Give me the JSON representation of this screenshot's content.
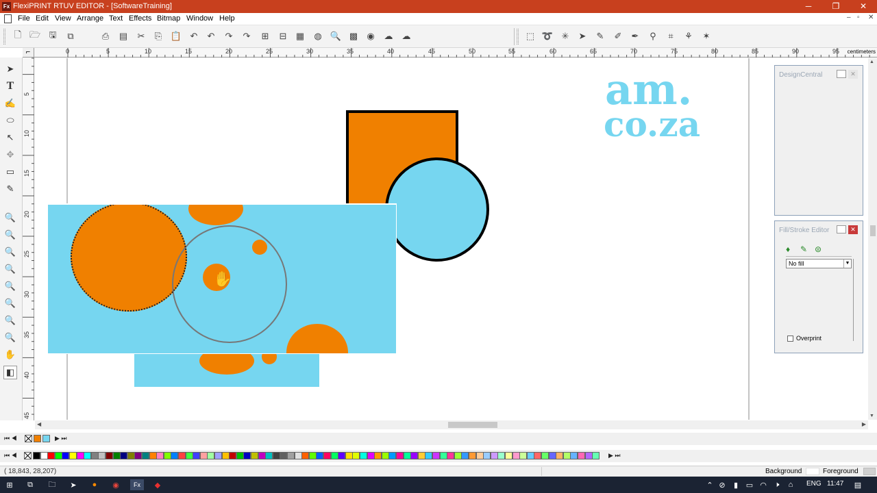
{
  "window": {
    "app_icon": "Fx",
    "title": "FlexiPRINT RTUV EDITOR - [SoftwareTraining]",
    "minimize": "─",
    "maximize": "❐",
    "close": "✕"
  },
  "menu": {
    "items": [
      "File",
      "Edit",
      "View",
      "Arrange",
      "Text",
      "Effects",
      "Bitmap",
      "Window",
      "Help"
    ],
    "mdi_minimize": "–",
    "mdi_restore": "▫",
    "mdi_close": "✕"
  },
  "toolbar": {
    "icons": [
      "new-icon",
      "open-icon",
      "save-icon",
      "save-all-icon",
      "print-icon",
      "production-manager-icon",
      "cut-icon",
      "copy-icon",
      "paste-icon",
      "undo-icon",
      "undo-list-icon",
      "redo-icon",
      "redo-list-icon",
      "group-icon",
      "ungroup-icon",
      "import-icon",
      "color-palette-icon",
      "zoom-icon",
      "color-swatch-icon",
      "color-wheel-icon",
      "cloud-icon",
      "cloud-upload-icon"
    ],
    "right_icons": [
      "marquee-select-icon",
      "lasso-select-icon",
      "magic-wand-icon",
      "arrow-select-icon",
      "pencil-icon",
      "brush-icon",
      "pen-icon",
      "stamp-icon",
      "crop-icon",
      "clone-icon",
      "wand-icon"
    ]
  },
  "ruler": {
    "corner": "⌐",
    "h_ticks": [
      "0",
      "5",
      "10",
      "15",
      "20",
      "25",
      "30",
      "35",
      "40",
      "45",
      "50",
      "55",
      "60",
      "65",
      "70",
      "75",
      "80",
      "85",
      "90",
      "95"
    ],
    "unit": "centimeters",
    "v_ticks": [
      "5",
      "10",
      "15",
      "20",
      "25",
      "30",
      "35",
      "40",
      "45"
    ]
  },
  "tools": [
    "select-tool-icon",
    "text-tool-icon",
    "shape-tool-icon",
    "ellipse-tool-icon",
    "node-edit-tool-icon",
    "fill-tool-icon",
    "measure-tool-icon",
    "eyedropper-tool-icon",
    "zoom-in-tool-icon",
    "zoom-out-tool-icon",
    "zoom-fit-tool-icon",
    "zoom-select-tool-icon",
    "zoom-all-tool-icon",
    "zoom-page-tool-icon",
    "pan-tool-icon",
    "fill-stroke-tool-icon"
  ],
  "artwork": {
    "logo_line1": "am.",
    "logo_line2": "co.za",
    "orange": "#f08000",
    "blue": "#76d6f0"
  },
  "panels": {
    "design_central": {
      "title": "DesignCentral"
    },
    "fill_stroke": {
      "title": "Fill/Stroke Editor",
      "fill_select": "No fill",
      "overprint_label": "Overprint"
    }
  },
  "palette": {
    "nav_left": "⏮ ◀",
    "nav_right": "▶ ⏭",
    "colors": [
      "#000000",
      "#ffffff",
      "#ff0000",
      "#00ff00",
      "#0000ff",
      "#ffff00",
      "#ff00ff",
      "#00ffff",
      "#808080",
      "#c0c0c0",
      "#800000",
      "#008000",
      "#000080",
      "#808000",
      "#800080",
      "#008080",
      "#ff8000",
      "#ff80c0",
      "#80ff00",
      "#0080ff",
      "#ff4040",
      "#40ff40",
      "#4040ff",
      "#ffa0a0",
      "#a0ffa0",
      "#a0a0ff",
      "#ffc000",
      "#c00000",
      "#00c000",
      "#0000c0",
      "#c0c000",
      "#c000c0",
      "#00c0c0",
      "#404040",
      "#606060",
      "#a0a0a0",
      "#e0e0e0",
      "#ff6000",
      "#60ff00",
      "#0060ff",
      "#ff0060",
      "#00ff60",
      "#6000ff",
      "#ffe000",
      "#e0ff00",
      "#00ffe0",
      "#e000ff",
      "#ff9900",
      "#99ff00",
      "#0099ff",
      "#ff0099",
      "#00ff99",
      "#9900ff",
      "#ffcc33",
      "#33ccff",
      "#cc33ff",
      "#33ff99",
      "#ff3399",
      "#99ff33",
      "#3399ff",
      "#ff9933",
      "#ffcc99",
      "#99ccff",
      "#cc99ff",
      "#99ffcc",
      "#ffff99",
      "#ff99cc",
      "#ccff99",
      "#66ccff",
      "#ff6666",
      "#66ff66",
      "#6666ff",
      "#ffb366",
      "#b3ff66",
      "#66b3ff",
      "#ff66b3",
      "#b366ff",
      "#66ffb3"
    ]
  },
  "status": {
    "coords": "( 18,843,    28,207)",
    "background_label": "Background",
    "foreground_label": "Foreground"
  },
  "taskbar": {
    "language": "ENG",
    "time": "11:47"
  }
}
